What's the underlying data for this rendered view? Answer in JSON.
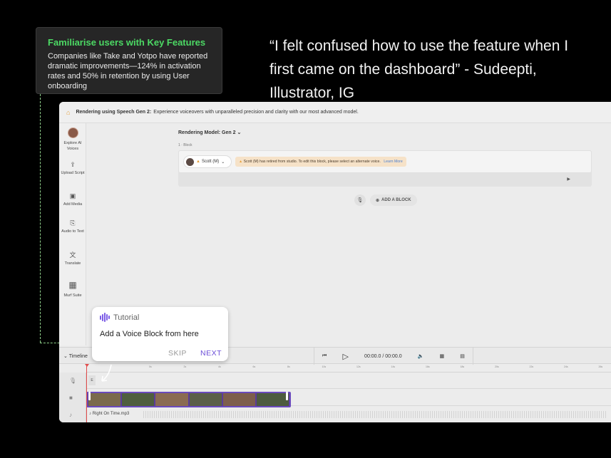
{
  "callout": {
    "title": "Familiarise users with Key Features",
    "text": "Companies like Take and Yotpo have reported dramatic improvements—124% in activation rates and 50% in retention by using User onboarding"
  },
  "quote": "“I felt confused how to use the feature when I first came on the dashboard” - Sudeepti, Illustrator, IG",
  "app": {
    "topbar": {
      "title": "Rendering using Speech Gen 2:",
      "subtitle": "Experience voiceovers with unparalleled precision and clarity with our most advanced model."
    },
    "sidebar": {
      "items": [
        {
          "label": "Explore AI Voices",
          "icon": "avatar"
        },
        {
          "label": "Upload Script",
          "icon": "upload-icon"
        },
        {
          "label": "Add Media",
          "icon": "media-icon"
        },
        {
          "label": "Audio to Text",
          "icon": "audio-text-icon"
        },
        {
          "label": "Translate",
          "icon": "translate-icon"
        },
        {
          "label": "Murf Suite",
          "icon": "grid-icon"
        }
      ]
    },
    "model_label": "Rendering Model: Gen 2",
    "block_label": "1 ·  Block",
    "voice_name": "Scott (M)",
    "warning": "Scott (M) has retired from studio. To edit this block, please select an alternate voice.",
    "learn_more": "Learn More",
    "add_block": "ADD A BLOCK",
    "timeline": {
      "label": "Timeline",
      "time": "00:00.0 / 00:00.0",
      "voice_chip": "E",
      "audio_file": "Right On Time.mp3",
      "ticks": [
        "0s",
        "2s",
        "4s",
        "6s",
        "8s",
        "10s",
        "12s",
        "14s",
        "16s",
        "18s",
        "20s",
        "22s",
        "24s",
        "26s",
        "28s",
        "30s"
      ]
    }
  },
  "tutorial": {
    "heading": "Tutorial",
    "message": "Add a Voice Block from here",
    "skip": "SKIP",
    "next": "NEXT"
  }
}
